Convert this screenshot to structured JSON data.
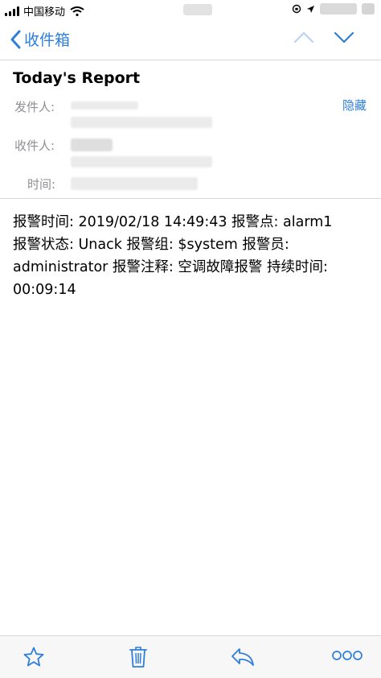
{
  "status_bar": {
    "carrier": "中国移动"
  },
  "nav": {
    "back_label": "收件箱"
  },
  "email": {
    "subject": "Today's Report",
    "from_label": "发件人:",
    "to_label": "收件人:",
    "time_label": "时间:",
    "hide_label": "隐藏",
    "body_lines": [
      "报警时间:  2019/02/18 14:49:43 报警点:  alarm1",
      "报警状态:  Unack 报警组:  $system 报警员:",
      "administrator 报警注释:  空调故障报警 持续时间:",
      "00:09:14"
    ]
  },
  "colors": {
    "accent": "#2f7ed8",
    "label_gray": "#8e8e93",
    "divider": "#d8d8d8"
  },
  "toolbar": {
    "icons": [
      "star-icon",
      "trash-icon",
      "reply-icon",
      "more-icon"
    ]
  }
}
